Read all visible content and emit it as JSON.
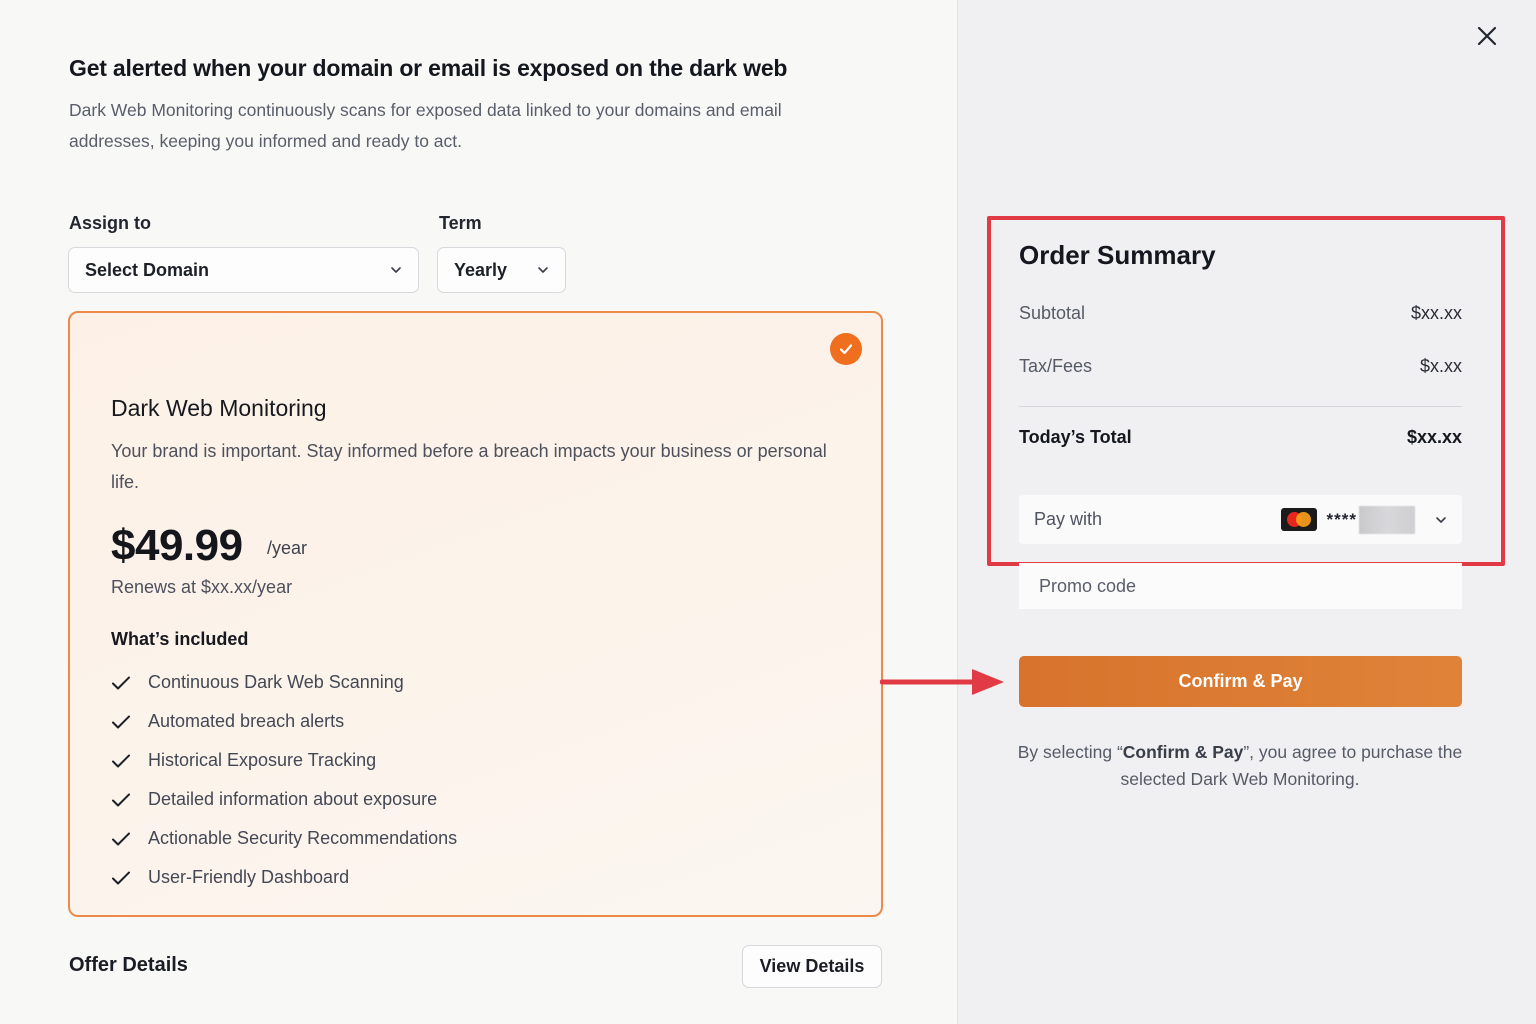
{
  "header": {
    "title": "Get alerted when your domain or email is exposed on the dark web",
    "subtitle": "Dark Web Monitoring continuously scans for exposed data linked to your domains and email addresses, keeping you informed and ready to act."
  },
  "form": {
    "assign_label": "Assign to",
    "assign_value": "Select Domain",
    "term_label": "Term",
    "term_value": "Yearly"
  },
  "plan": {
    "title": "Dark Web Monitoring",
    "description": "Your brand is important. Stay informed before a breach impacts your business or personal life.",
    "price": "$49.99",
    "period": "/year",
    "renews": "Renews at $xx.xx/year",
    "included_title": "What’s included",
    "features": [
      "Continuous Dark Web Scanning",
      "Automated breach alerts",
      "Historical Exposure Tracking",
      "Detailed information about exposure",
      "Actionable Security Recommendations",
      "User-Friendly Dashboard"
    ],
    "selected": true
  },
  "offer": {
    "title": "Offer Details",
    "button_label": "View Details"
  },
  "summary": {
    "title": "Order Summary",
    "subtotal_label": "Subtotal",
    "subtotal_value": "$xx.xx",
    "tax_label": "Tax/Fees",
    "tax_value": "$x.xx",
    "total_label": "Today’s Total",
    "total_value": "$xx.xx",
    "pay_with_label": "Pay with",
    "card_mask": "****",
    "promo_placeholder": "Promo code",
    "confirm_label": "Confirm & Pay",
    "agree_prefix": "By selecting “",
    "agree_bold": "Confirm & Pay",
    "agree_suffix": "”, you agree to purchase the selected Dark Web Monitoring."
  },
  "colors": {
    "accent": "#e07d34",
    "card_border": "#ec8a4a",
    "badge": "#ef6f1e",
    "highlight": "#e23a44"
  },
  "icons": {
    "close": "close-icon",
    "chevron": "chevron-down-icon",
    "check": "check-icon",
    "card": "mastercard-icon",
    "arrow": "arrow-right-icon"
  }
}
